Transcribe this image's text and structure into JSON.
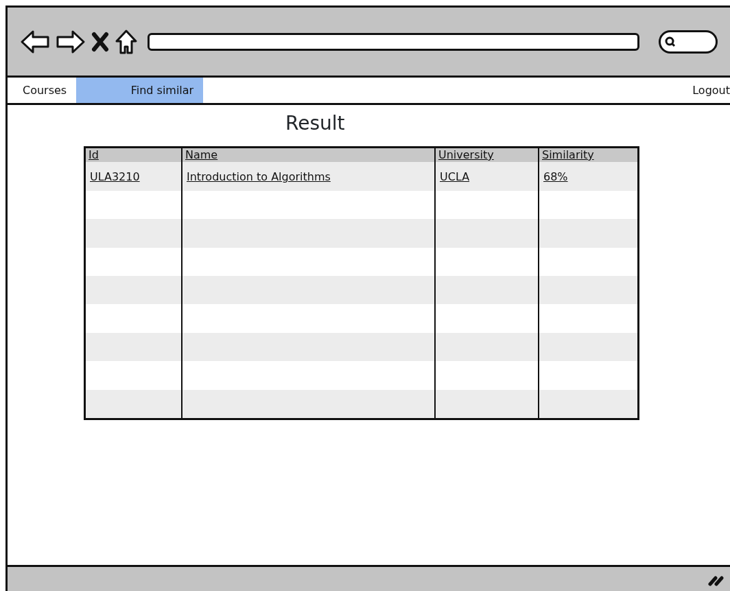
{
  "nav": {
    "items": [
      {
        "label": "Courses",
        "selected": false
      },
      {
        "label": "Find similar",
        "selected": true
      }
    ],
    "right_item": {
      "label": "Logout"
    }
  },
  "title": "Result",
  "table": {
    "columns": [
      "Id",
      "Name",
      "University",
      "Similarity"
    ],
    "rows": [
      [
        "ULA3210",
        "Introduction to Algorithms",
        "UCLA",
        "68%"
      ]
    ]
  }
}
